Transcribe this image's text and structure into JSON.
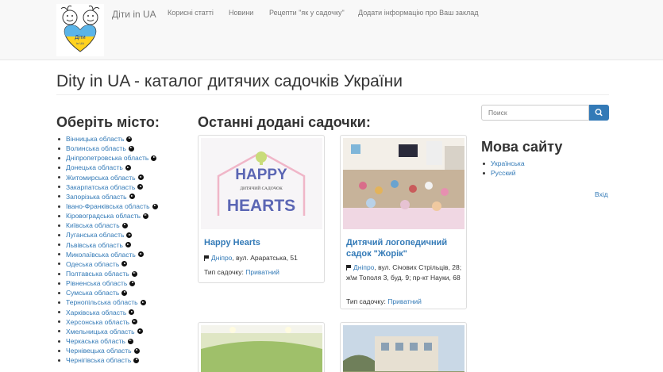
{
  "navbar": {
    "brand": "Діти in UA",
    "logo_text": "Діти",
    "logo_subtext": "in UA",
    "items": [
      {
        "label": "Корисні статті"
      },
      {
        "label": "Новини"
      },
      {
        "label": "Рецепти \"як у садочку\""
      },
      {
        "label": "Додати інформацію про Ваш заклад"
      }
    ]
  },
  "page": {
    "title": "Dity in UA - каталог дитячих садочків України"
  },
  "cities": {
    "heading": "Оберіть місто:",
    "regions": [
      "Вінницька область",
      "Волинська область",
      "Дніпропетровська область",
      "Донецька область",
      "Житомирська область",
      "Закарпатська область",
      "Запорізька область",
      "Івано-Франківська область",
      "Кіровоградська область",
      "Київська область",
      "Луганська область",
      "Львівська область",
      "Миколаївська область",
      "Одеська область",
      "Полтавська область",
      "Рівненська область",
      "Сумська область",
      "Тернопільська область",
      "Харківська область",
      "Херсонська область",
      "Хмельницька область",
      "Черкаська область",
      "Чернівецька область",
      "Чернігівська область"
    ]
  },
  "latest": {
    "heading": "Останні додані садочки:",
    "type_label": "Тип садочку:",
    "cards": [
      {
        "title": "Happy Hearts",
        "city": "Дніпро",
        "address": ", вул. Араратська, 51",
        "type": "Приватний",
        "logo_line1": "HAPPY",
        "logo_line2": "HEARTS",
        "logo_caption": "ДИТЯЧИЙ САДОЧОК"
      },
      {
        "title": "Дитячий логопедичний садок \"Жорік\"",
        "city": "Дніпро",
        "address": ", вул. Січових Стрільців, 28; ж\\м Тополя 3, буд. 9; пр-кт Науки, 68",
        "type": "Приватний"
      }
    ]
  },
  "sidebar": {
    "search_placeholder": "Поиск",
    "language_heading": "Мова сайту",
    "languages": [
      "Українська",
      "Русский"
    ],
    "login": "Вхід"
  },
  "colors": {
    "link": "#337ab7",
    "navbar_bg": "#f8f8f8",
    "button": "#337ab7"
  },
  "icons": [
    "search-icon",
    "chevron-right-circle-icon",
    "flag-icon"
  ]
}
